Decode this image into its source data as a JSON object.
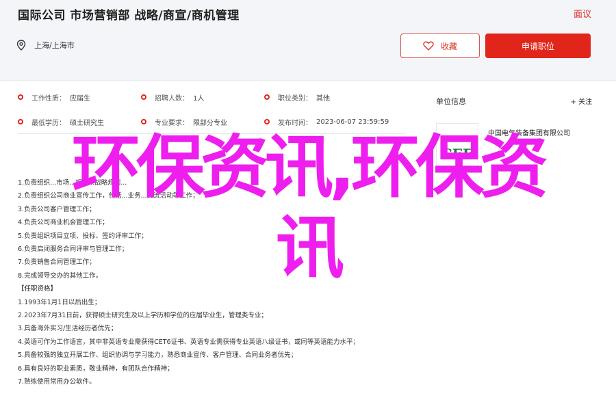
{
  "header": {
    "title": "国际公司 市场营销部 战略/商宣/商机管理",
    "report": "面议",
    "location": "上海/上海市",
    "favorite_label": "收藏",
    "apply_label": "申请职位"
  },
  "info": [
    [
      {
        "label": "工作性质：",
        "value": "应届生"
      },
      {
        "label": "招聘人数：",
        "value": "1人"
      },
      {
        "label": "职位类别：",
        "value": "其他"
      }
    ],
    [
      {
        "label": "最低学历：",
        "value": "硕士研究生"
      },
      {
        "label": "专业要求：",
        "value": "限部分专业"
      },
      {
        "label": "发布时间：",
        "value": "2023-06-07 23:59:59"
      }
    ]
  ],
  "description": {
    "lines": [
      "1.负责组织...市场...相关...战略规划...",
      "2.负责组织公司商业宣传工作，包括...业务...交流活动等工作；",
      "3.负责公司客户管理工作；",
      "4.负责公司商业机会管理工作；",
      "5.负责组织项目立项、投标、签约评审工作；",
      "6.负责启闭服务合同评审与管理工作；",
      "7.负责销售合同管理工作；",
      "8.完成领导交办的其他工作。",
      "【任职资格】",
      "1.1993年1月1日以后出生；",
      "2.2023年7月31日前，获得硕士研究生及以上学历和学位的应届毕业生，管理类专业；",
      "3.具备海外实习/生活经历者优先；",
      "4.英语可作为工作语言，其中非英语专业需获得CET6证书、英语专业需获得专业英语八级证书，或同等英语能力水平；",
      "5.具备较强的独立开展工作、组织协调与学习能力，熟悉商业宣传、客户管理、合同业务者优先；",
      "6.具有良好的职业素质，敬业精神，有团队合作精神；",
      "7.熟练使用常用办公软件。"
    ]
  },
  "sidebar": {
    "title": "单位信息",
    "follow_label": "+ 关注",
    "company_name": "中国电气装备集团有限公司",
    "logo_text": "CEE"
  },
  "overlay": {
    "line1": "环保资讯,环保资",
    "line2": "讯"
  }
}
